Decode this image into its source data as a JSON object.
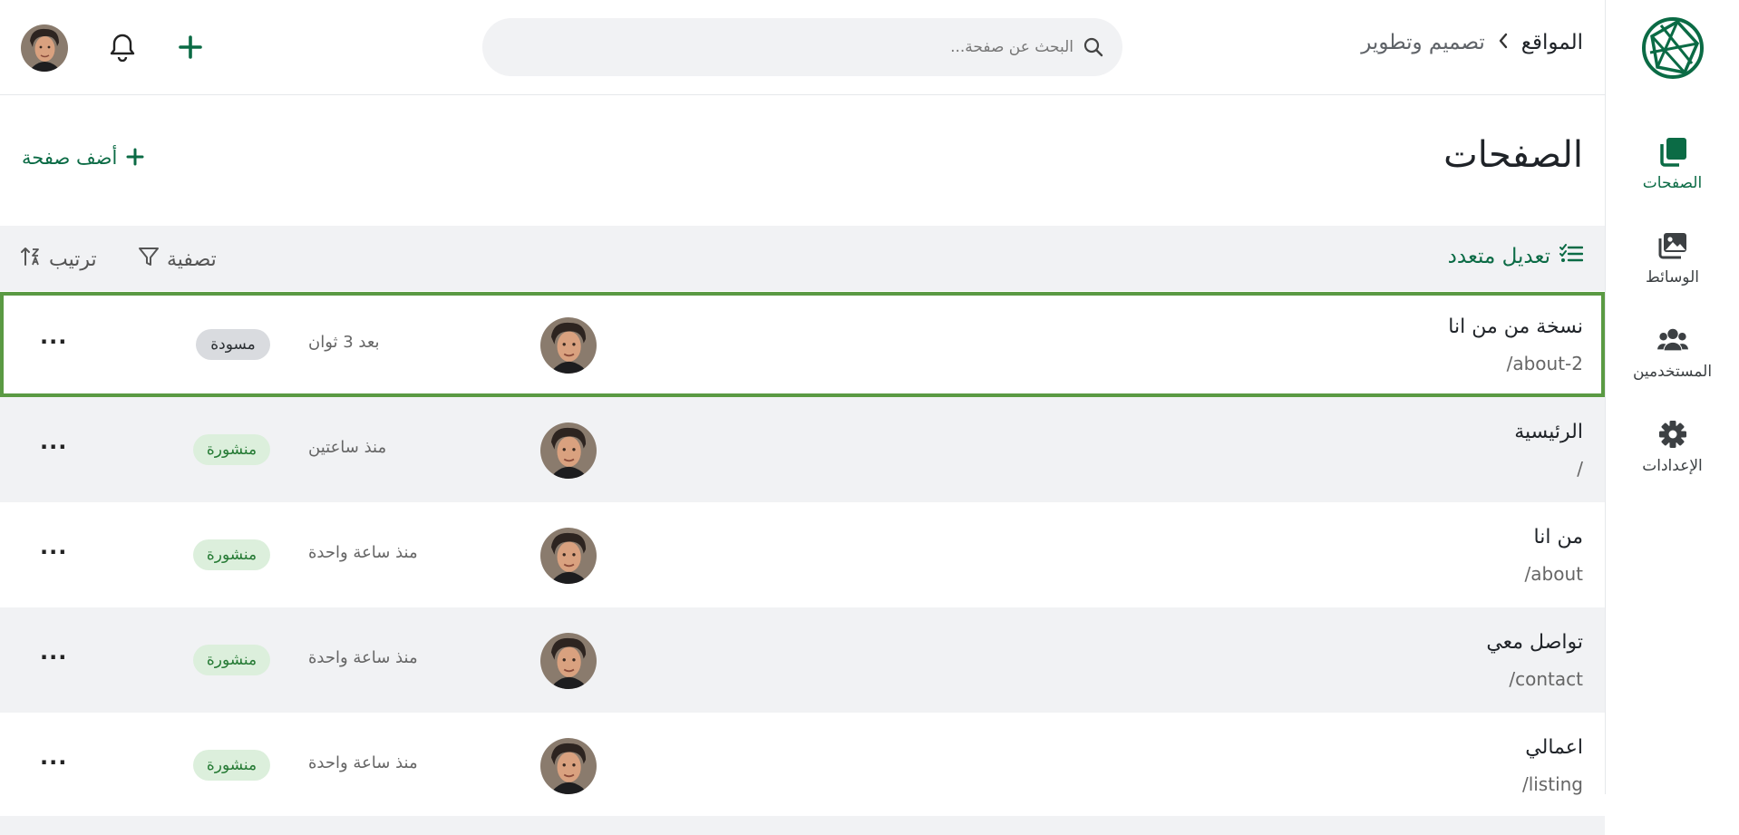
{
  "colors": {
    "brand": "#0b6b45",
    "selected_outline": "#5a9a43",
    "published_bg": "#dcefdc",
    "draft_bg": "#d9dbdf"
  },
  "rail": {
    "logo_icon": "site-logo",
    "items": [
      {
        "label": "الصفحات",
        "icon": "pages-icon",
        "active": true
      },
      {
        "label": "الوسائط",
        "icon": "media-icon"
      },
      {
        "label": "المستخدمين",
        "icon": "users-icon"
      },
      {
        "label": "الإعدادات",
        "icon": "settings-gear-icon"
      }
    ]
  },
  "topbar": {
    "breadcrumb_root": "المواقع",
    "breadcrumb_current": "تصميم وتطوير",
    "search_placeholder": "البحث عن صفحة..."
  },
  "page": {
    "title": "الصفحات",
    "add_label": "أضف صفحة"
  },
  "toolbar": {
    "bulk_edit": "تعديل متعدد",
    "filter": "تصفية",
    "sort": "ترتيب"
  },
  "rows": [
    {
      "title": "نسخة من من انا",
      "slug": "/about-2",
      "time": "بعد 3 ثوان",
      "status": "مسودة",
      "status_type": "draft",
      "selected": true
    },
    {
      "title": "الرئيسية",
      "slug": "/",
      "time": "منذ ساعتين",
      "status": "منشورة",
      "status_type": "published"
    },
    {
      "title": "من انا",
      "slug": "/about",
      "time": "منذ ساعة واحدة",
      "status": "منشورة",
      "status_type": "published"
    },
    {
      "title": "تواصل معي",
      "slug": "/contact",
      "time": "منذ ساعة واحدة",
      "status": "منشورة",
      "status_type": "published"
    },
    {
      "title": "اعمالي",
      "slug": "/listing",
      "time": "منذ ساعة واحدة",
      "status": "منشورة",
      "status_type": "published"
    }
  ],
  "more_label": "···"
}
